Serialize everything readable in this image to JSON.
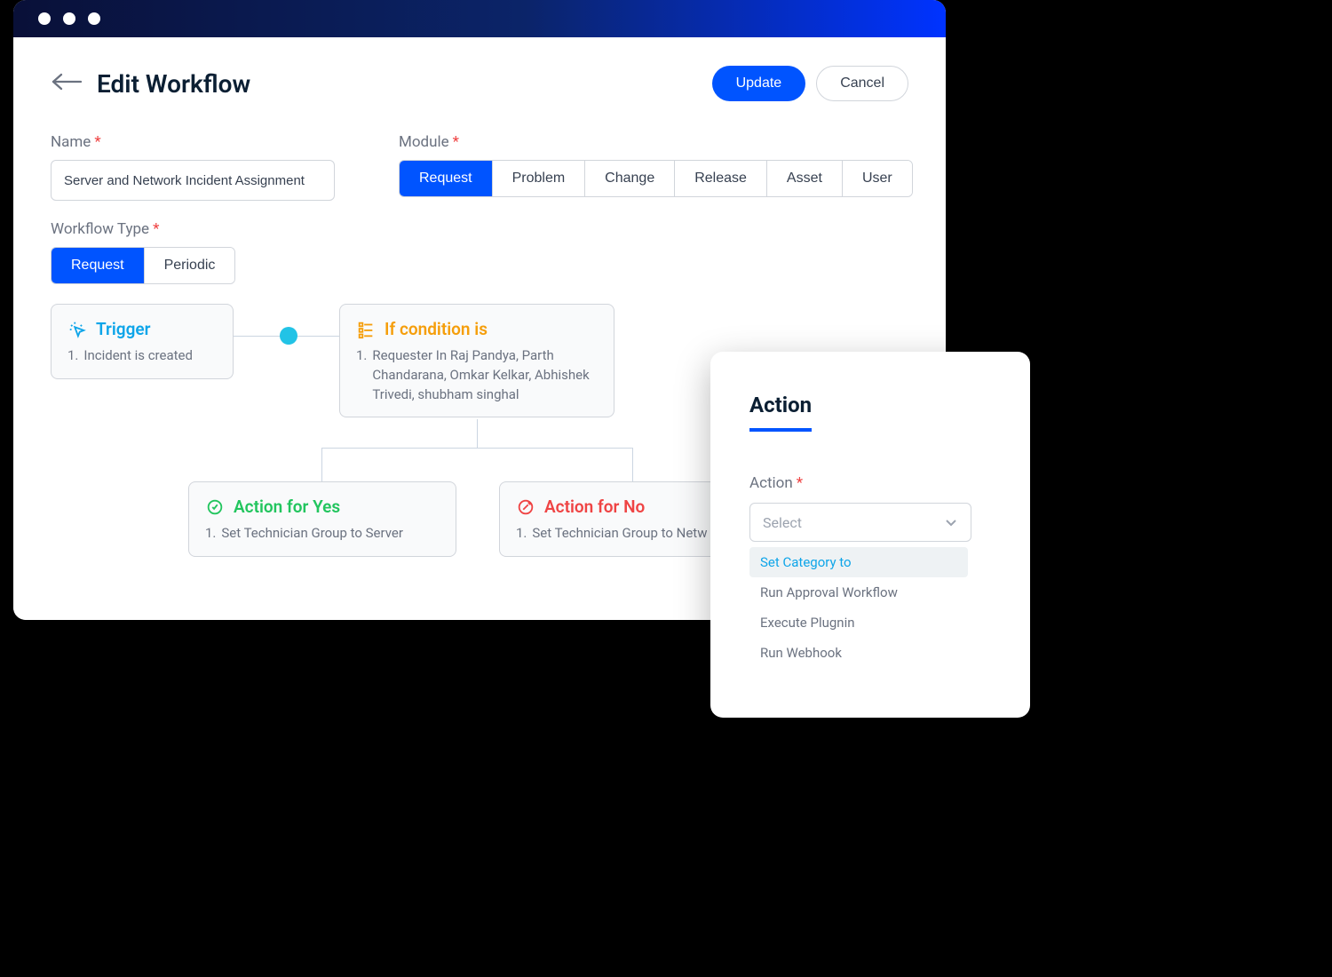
{
  "header": {
    "title": "Edit Workflow",
    "update_label": "Update",
    "cancel_label": "Cancel"
  },
  "form": {
    "name_label": "Name",
    "name_value": "Server and Network Incident Assignment",
    "module_label": "Module",
    "modules": [
      "Request",
      "Problem",
      "Change",
      "Release",
      "Asset",
      "User"
    ],
    "module_selected": "Request",
    "workflow_type_label": "Workflow Type",
    "workflow_types": [
      "Request",
      "Periodic"
    ],
    "workflow_type_selected": "Request"
  },
  "diagram": {
    "trigger": {
      "title": "Trigger",
      "items": [
        "Incident is created"
      ]
    },
    "condition": {
      "title": "If condition is",
      "items": [
        "Requester In Raj Pandya, Parth Chandarana, Omkar Kelkar, Abhishek Trivedi, shubham singhal"
      ]
    },
    "yes": {
      "title": "Action for Yes",
      "items": [
        "Set Technician Group to Server"
      ]
    },
    "no": {
      "title": "Action for No",
      "items": [
        "Set Technician Group to Netw"
      ]
    }
  },
  "action_panel": {
    "title": "Action",
    "field_label": "Action",
    "placeholder": "Select",
    "options": [
      "Set Category to",
      "Run Approval Workflow",
      "Execute Plugnin",
      "Run Webhook"
    ],
    "highlighted": "Set Category to"
  }
}
